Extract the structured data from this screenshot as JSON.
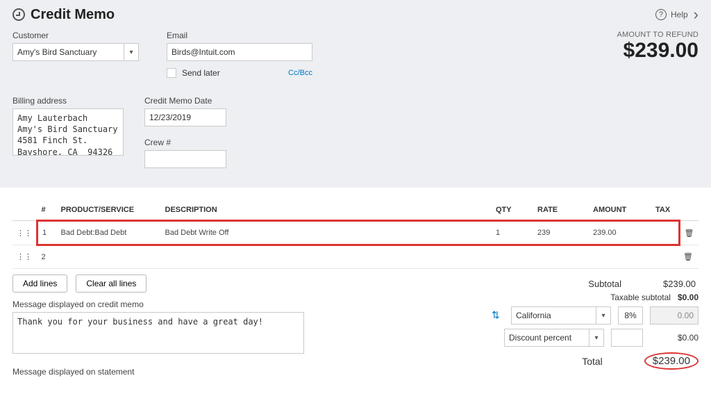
{
  "header": {
    "title": "Credit Memo",
    "help": "Help"
  },
  "amount": {
    "label": "AMOUNT TO REFUND",
    "value": "$239.00"
  },
  "customer": {
    "label": "Customer",
    "value": "Amy's Bird Sanctuary"
  },
  "email": {
    "label": "Email",
    "value": "Birds@Intuit.com",
    "send_later": "Send later",
    "ccbcc": "Cc/Bcc"
  },
  "billing": {
    "label": "Billing address",
    "value": "Amy Lauterbach\nAmy's Bird Sanctuary\n4581 Finch St.\nBayshore, CA  94326"
  },
  "date": {
    "label": "Credit Memo Date",
    "value": "12/23/2019"
  },
  "crew": {
    "label": "Crew #",
    "value": ""
  },
  "table": {
    "cols": {
      "num": "#",
      "product": "PRODUCT/SERVICE",
      "desc": "DESCRIPTION",
      "qty": "QTY",
      "rate": "RATE",
      "amount": "AMOUNT",
      "tax": "TAX"
    },
    "rows": [
      {
        "num": "1",
        "product": "Bad Debt:Bad Debt",
        "desc": "Bad Debt Write Off",
        "qty": "1",
        "rate": "239",
        "amount": "239.00"
      },
      {
        "num": "2",
        "product": "",
        "desc": "",
        "qty": "",
        "rate": "",
        "amount": ""
      }
    ]
  },
  "buttons": {
    "add_lines": "Add lines",
    "clear_lines": "Clear all lines"
  },
  "subtotal": {
    "label": "Subtotal",
    "value": "$239.00"
  },
  "msg_memo": {
    "label": "Message displayed on credit memo",
    "value": "Thank you for your business and have a great day!"
  },
  "taxable_subtotal": {
    "label": "Taxable subtotal",
    "value": "$0.00"
  },
  "tax_calc": {
    "region": "California",
    "percent": "8%",
    "amount": "0.00"
  },
  "discount": {
    "type": "Discount percent",
    "value": "",
    "amount": "$0.00"
  },
  "total": {
    "label": "Total",
    "value": "$239.00"
  },
  "msg_statement": {
    "label": "Message displayed on statement"
  }
}
